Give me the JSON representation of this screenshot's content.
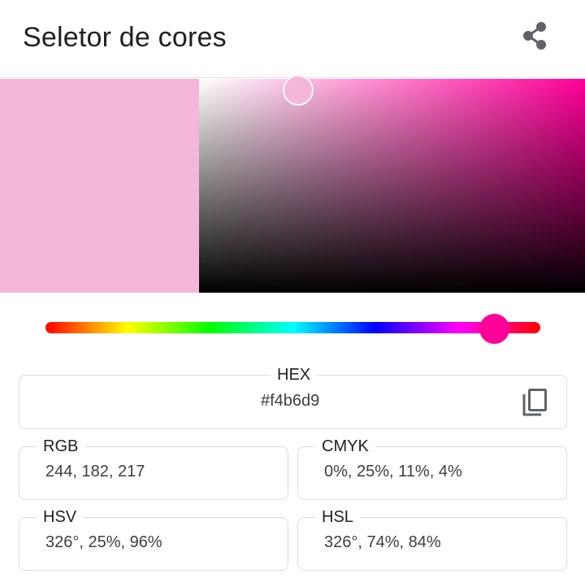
{
  "app": {
    "title": "Seletor de cores",
    "share_icon": "share-icon"
  },
  "color": {
    "current": "#f4b6d9",
    "hue_color": "#ff0099",
    "hue_degrees": 326,
    "saturation": 0.25,
    "value": 0.96
  },
  "fields": {
    "hex": {
      "label": "HEX",
      "value": "#f4b6d9",
      "copy_icon": "copy-icon"
    },
    "rgb": {
      "label": "RGB",
      "value": "244, 182, 217"
    },
    "cmyk": {
      "label": "CMYK",
      "value": "0%, 25%, 11%, 4%"
    },
    "hsv": {
      "label": "HSV",
      "value": "326°, 25%, 96%"
    },
    "hsl": {
      "label": "HSL",
      "value": "326°, 74%, 84%"
    }
  }
}
